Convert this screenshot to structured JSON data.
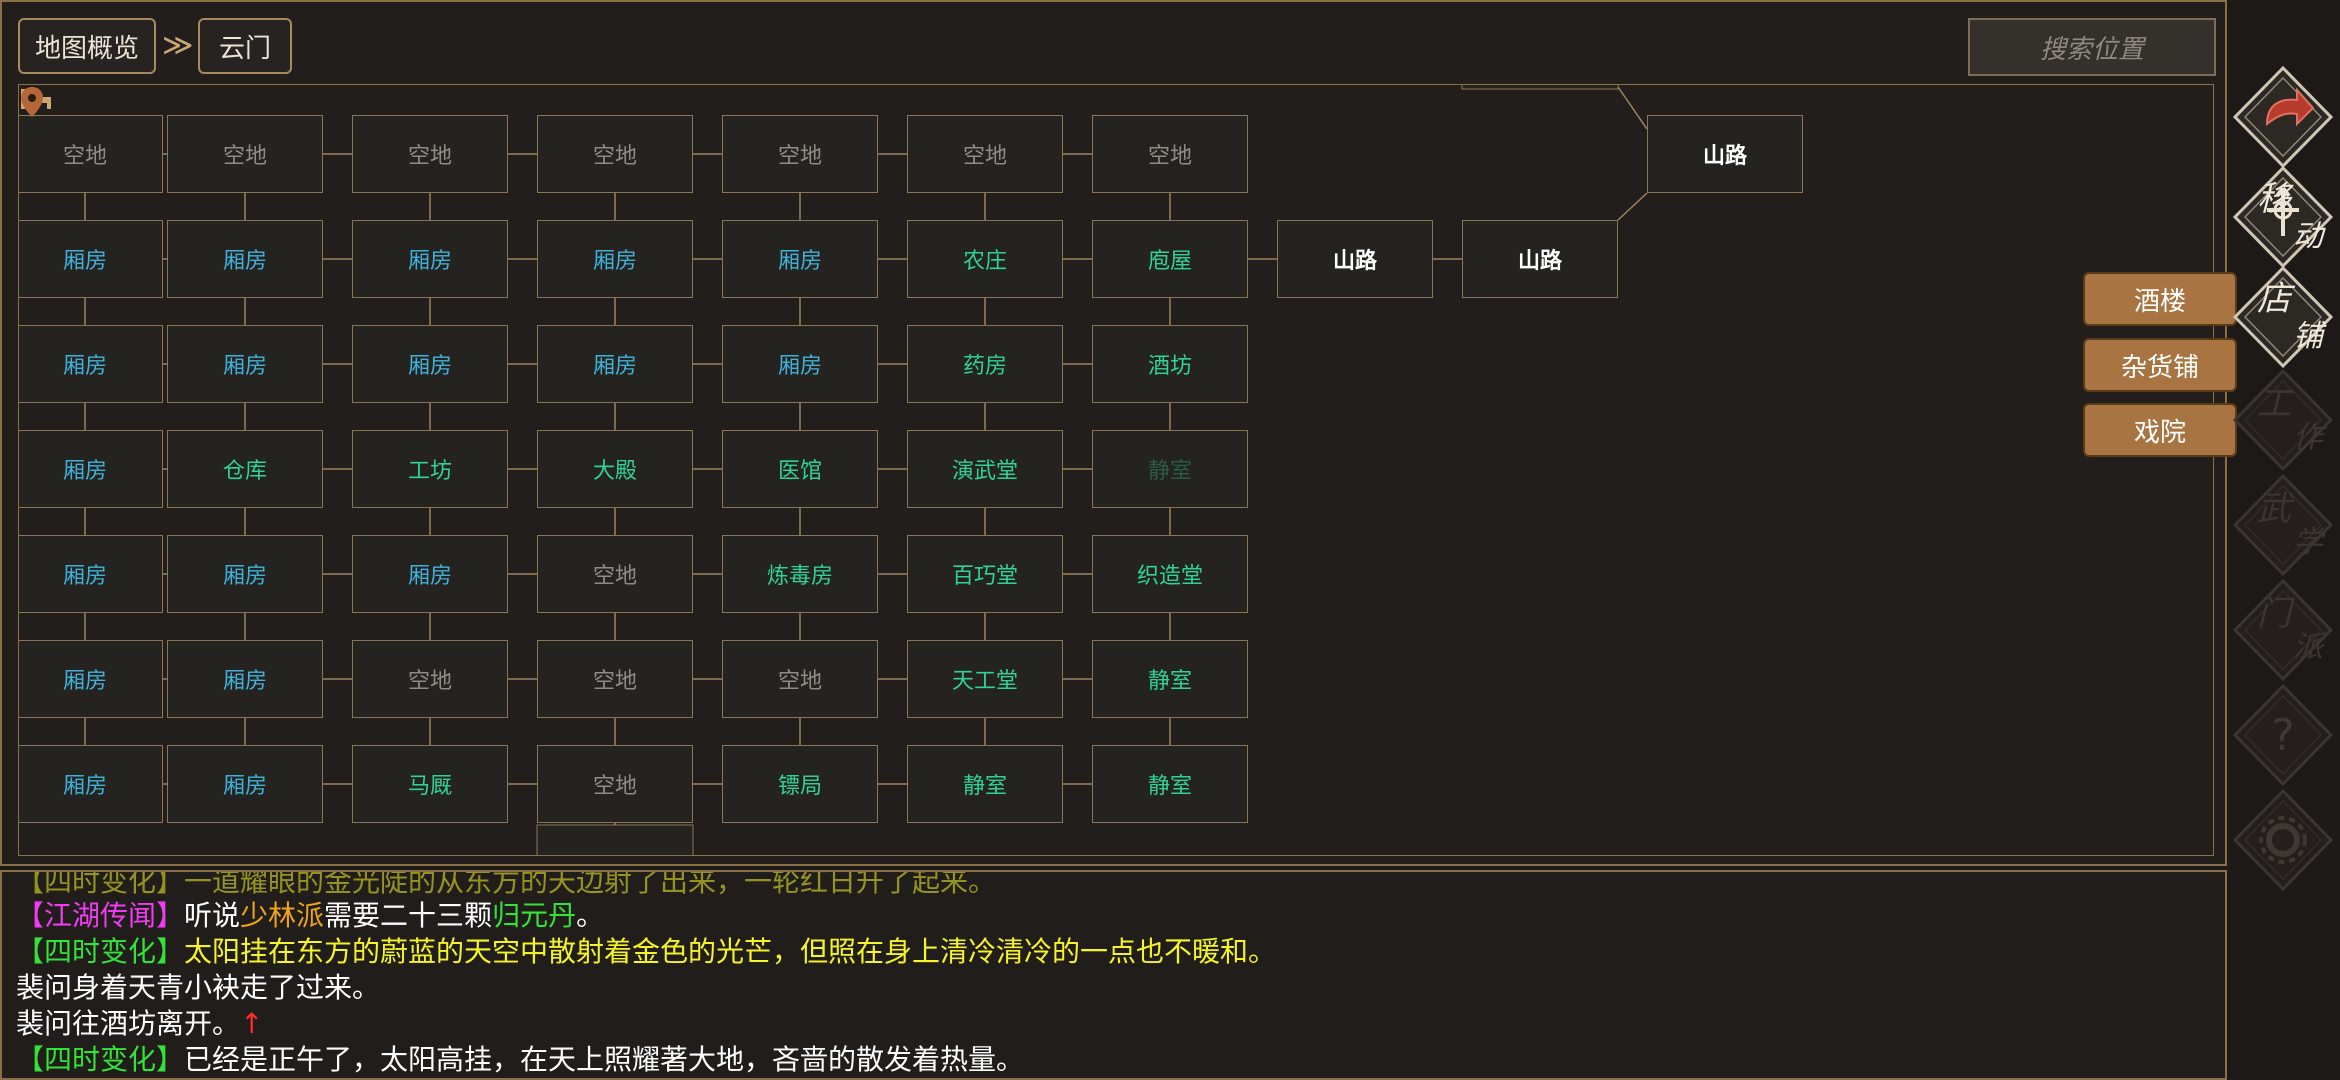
{
  "breadcrumb": {
    "root": "地图概览",
    "current": "云门"
  },
  "search": {
    "placeholder": "搜索位置"
  },
  "map": {
    "nodes": [
      {
        "label": "空地",
        "style": "gray"
      },
      {
        "label": "空地",
        "style": "gray"
      },
      {
        "label": "空地",
        "style": "gray"
      },
      {
        "label": "空地",
        "style": "gray"
      },
      {
        "label": "空地",
        "style": "gray"
      },
      {
        "label": "空地",
        "style": "gray"
      },
      {
        "label": "空地",
        "style": "gray"
      },
      {
        "label": "山路",
        "style": "white"
      },
      {
        "label": "厢房",
        "style": "blue"
      },
      {
        "label": "厢房",
        "style": "blue"
      },
      {
        "label": "厢房",
        "style": "blue"
      },
      {
        "label": "厢房",
        "style": "blue"
      },
      {
        "label": "厢房",
        "style": "blue"
      },
      {
        "label": "农庄",
        "style": "green"
      },
      {
        "label": "庖屋",
        "style": "green"
      },
      {
        "label": "山路",
        "style": "white"
      },
      {
        "label": "山路",
        "style": "white"
      },
      {
        "label": "厢房",
        "style": "blue"
      },
      {
        "label": "厢房",
        "style": "blue"
      },
      {
        "label": "厢房",
        "style": "blue"
      },
      {
        "label": "厢房",
        "style": "blue"
      },
      {
        "label": "厢房",
        "style": "blue"
      },
      {
        "label": "药房",
        "style": "green"
      },
      {
        "label": "酒坊",
        "style": "green"
      },
      {
        "label": "厢房",
        "style": "blue"
      },
      {
        "label": "仓库",
        "style": "green"
      },
      {
        "label": "工坊",
        "style": "green"
      },
      {
        "label": "大殿",
        "style": "green"
      },
      {
        "label": "医馆",
        "style": "green"
      },
      {
        "label": "演武堂",
        "style": "green"
      },
      {
        "label": "静室",
        "style": "dim"
      },
      {
        "label": "厢房",
        "style": "blue"
      },
      {
        "label": "厢房",
        "style": "blue"
      },
      {
        "label": "厢房",
        "style": "blue"
      },
      {
        "label": "空地",
        "style": "gray"
      },
      {
        "label": "炼毒房",
        "style": "green"
      },
      {
        "label": "百巧堂",
        "style": "green"
      },
      {
        "label": "织造堂",
        "style": "green"
      },
      {
        "label": "厢房",
        "style": "blue"
      },
      {
        "label": "厢房",
        "style": "blue"
      },
      {
        "label": "空地",
        "style": "gray"
      },
      {
        "label": "空地",
        "style": "gray"
      },
      {
        "label": "空地",
        "style": "gray"
      },
      {
        "label": "天工堂",
        "style": "green"
      },
      {
        "label": "静室",
        "style": "green"
      },
      {
        "label": "厢房",
        "style": "blue"
      },
      {
        "label": "厢房",
        "style": "blue"
      },
      {
        "label": "马厩",
        "style": "green"
      },
      {
        "label": "空地",
        "style": "gray"
      },
      {
        "label": "镖局",
        "style": "green"
      },
      {
        "label": "静室",
        "style": "green"
      },
      {
        "label": "静室",
        "style": "green"
      }
    ]
  },
  "shop_buttons": [
    "酒楼",
    "杂货铺",
    "戏院"
  ],
  "sidebar": {
    "icons": [
      {
        "name": "back",
        "label": ""
      },
      {
        "name": "move",
        "label": "移动"
      },
      {
        "name": "shop",
        "label": "店铺"
      },
      {
        "name": "work",
        "label": "工作"
      },
      {
        "name": "martial",
        "label": "武学"
      },
      {
        "name": "sect",
        "label": "门派"
      },
      {
        "name": "help",
        "label": "?"
      },
      {
        "name": "settings",
        "label": ""
      }
    ]
  },
  "log": {
    "partial_top": "【四时变化】一道耀眼的金光陡的从东方的天边射了出来，一轮红日升了起来。",
    "line1": {
      "tag": "【江湖传闻】",
      "t1": "听说",
      "sect": "少林派",
      "t2": "需要二十三颗",
      "item": "归元丹",
      "t3": "。"
    },
    "line2": {
      "tag": "【四时变化】",
      "text": "太阳挂在东方的蔚蓝的天空中散射着金色的光芒，但照在身上清冷清冷的一点也不暖和。"
    },
    "line3": "裴问身着天青小袂走了过来。",
    "line4": {
      "text": "裴问往酒坊离开。",
      "arrow": "↑"
    },
    "line5": {
      "tag": "【四时变化】",
      "text": "已经是正午了，太阳高挂，在天上照耀著大地，吝啬的散发着热量。"
    }
  },
  "colors": {
    "blue": "#3fb2dc",
    "green": "#2fd395",
    "gold": "#a87542",
    "border": "#8a6f47"
  }
}
